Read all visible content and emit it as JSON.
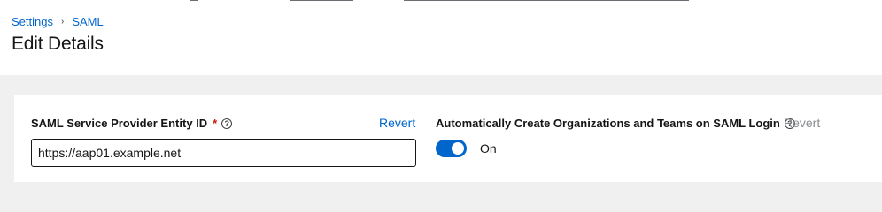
{
  "breadcrumb": {
    "items": [
      "Settings",
      "SAML"
    ],
    "separator": "›"
  },
  "page": {
    "title": "Edit Details"
  },
  "form": {
    "entity_id": {
      "label": "SAML Service Provider Entity ID",
      "required_marker": "*",
      "help_icon": "question-circle-icon",
      "revert_label": "Revert",
      "value": "https://aap01.example.net"
    },
    "auto_create": {
      "label": "Automatically Create Organizations and Teams on SAML Login",
      "help_icon": "question-circle-icon",
      "revert_label": "Revert",
      "toggle_state": "On"
    }
  },
  "colors": {
    "link": "#0066cc",
    "toggle_on": "#0066cc",
    "required": "#c9190b",
    "page_bg": "#f0f0f0"
  }
}
